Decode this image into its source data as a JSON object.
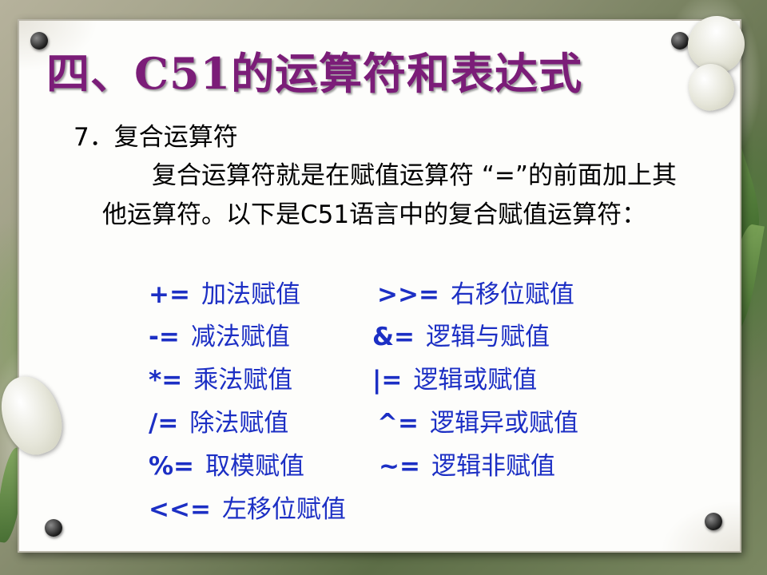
{
  "title": "四、C51的运算符和表达式",
  "subhead": "7．复合运算符",
  "paragraph": "复合运算符就是在赋值运算符 “=”的前面加上其他运算符。以下是C51语言中的复合赋值运算符：",
  "left_ops": [
    {
      "symbol": "+=",
      "name": "加法赋值"
    },
    {
      "symbol": "-=",
      "name": "减法赋值"
    },
    {
      "symbol": "*=",
      "name": "乘法赋值"
    },
    {
      "symbol": "/=",
      "name": "除法赋值"
    },
    {
      "symbol": "%=",
      "name": "取模赋值"
    },
    {
      "symbol": "<<=",
      "name": "左移位赋值"
    }
  ],
  "right_ops": [
    {
      "symbol": ">>=",
      "name": "右移位赋值"
    },
    {
      "symbol": "&=",
      "name": "逻辑与赋值"
    },
    {
      "symbol": "|=",
      "name": "逻辑或赋值"
    },
    {
      "symbol": "^=",
      "name": "逻辑异或赋值"
    },
    {
      "symbol": "~=",
      "name": "逻辑非赋值"
    }
  ],
  "colors": {
    "title": "#7b1d78",
    "operators": "#1c2fc4",
    "body_text": "#000000"
  }
}
